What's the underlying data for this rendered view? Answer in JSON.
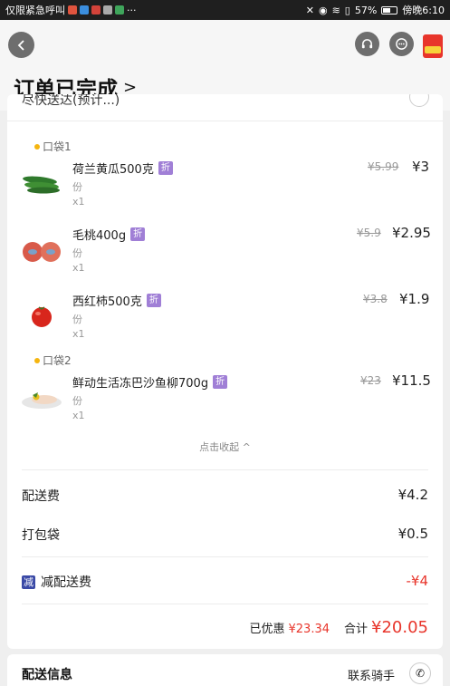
{
  "status_bar": {
    "carrier": "仅限紧急呼叫",
    "more": "···",
    "battery": "57%",
    "time": "傍晚6:10",
    "battery_level": 0.57
  },
  "header": {
    "title": "订单已完成"
  },
  "order": {
    "partial_top_text": "尽快送达(预计...)",
    "bags": [
      {
        "label": "口袋1"
      },
      {
        "label": "口袋2"
      }
    ],
    "items": [
      {
        "name": "荷兰黄瓜500克",
        "tag": "折",
        "unit": "份",
        "qty": "x1",
        "old_price": "¥5.99",
        "price": "¥3",
        "icon": "cucumber-icon"
      },
      {
        "name": "毛桃400g",
        "tag": "折",
        "unit": "份",
        "qty": "x1",
        "old_price": "¥5.9",
        "price": "¥2.95",
        "icon": "peach-icon"
      },
      {
        "name": "西红柿500克",
        "tag": "折",
        "unit": "份",
        "qty": "x1",
        "old_price": "¥3.8",
        "price": "¥1.9",
        "icon": "tomato-icon"
      },
      {
        "name": "鲜动生活冻巴沙鱼柳700g",
        "tag": "折",
        "unit": "份",
        "qty": "x1",
        "old_price": "¥23",
        "price": "¥11.5",
        "icon": "fish-fillet-icon"
      }
    ],
    "collapse_label": "点击收起 ^",
    "fees": [
      {
        "label": "配送费",
        "value": "¥4.2"
      },
      {
        "label": "打包袋",
        "value": "¥0.5"
      }
    ],
    "discount": {
      "badge": "减",
      "label": "减配送费",
      "value": "-¥4"
    },
    "total": {
      "saved_label": "已优惠",
      "saved_value": "¥23.34",
      "total_label": "合计",
      "total_value": "¥20.05"
    }
  },
  "delivery": {
    "title": "配送信息",
    "contact_label": "联系骑手"
  },
  "colors": {
    "accent_red": "#e8352b",
    "discount_tag": "#a07fd6",
    "reduce_badge": "#3a49a6"
  }
}
